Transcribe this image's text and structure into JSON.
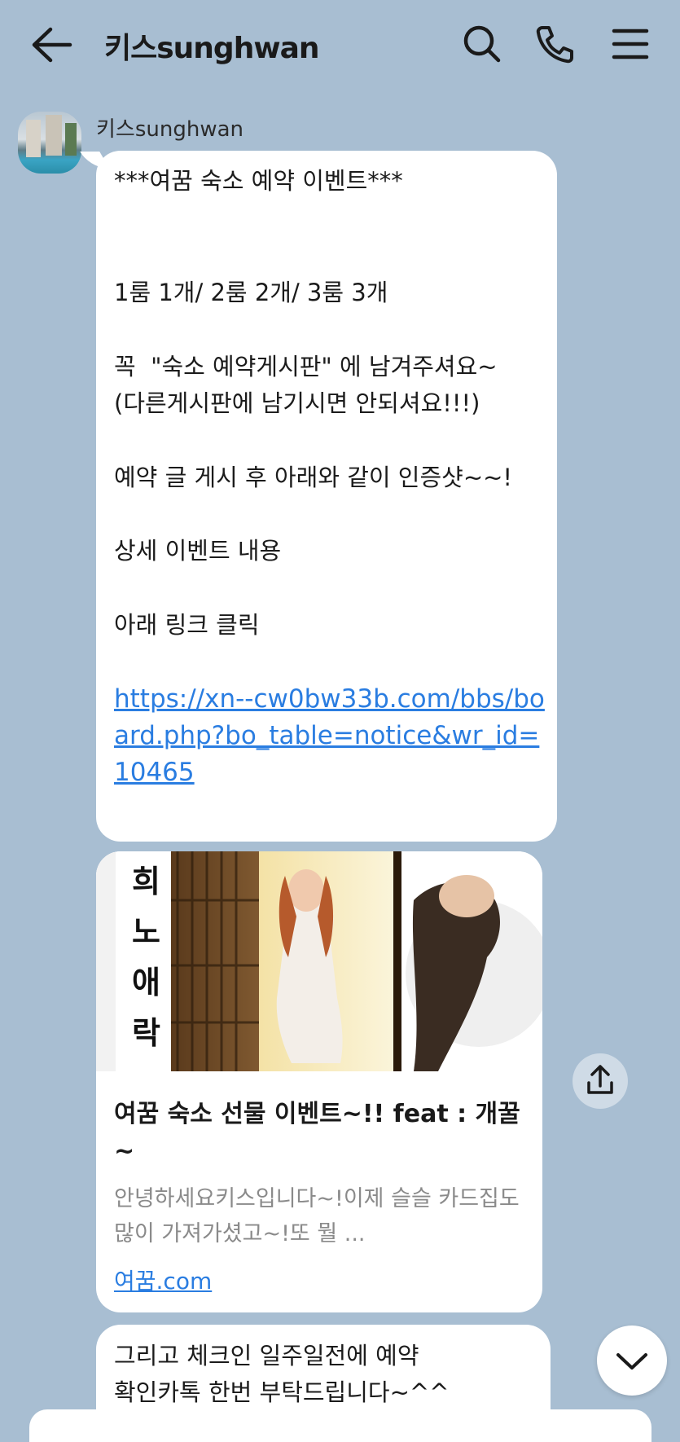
{
  "header": {
    "title": "키스sunghwan",
    "back_icon": "arrow-left-icon",
    "search_icon": "search-icon",
    "call_icon": "phone-icon",
    "menu_icon": "hamburger-menu-icon"
  },
  "sender": {
    "name": "키스sunghwan"
  },
  "messages": {
    "first": {
      "line1": "***여꿈 숙소 예약 이벤트***",
      "line2": "1룸 1개/ 2룸 2개/ 3룸 3개",
      "line3": "꼭  \"숙소 예약게시판\" 에 남겨주셔요~",
      "line4": "(다른게시판에 남기시면 안되셔요!!!)",
      "line5": "예약 글 게시 후 아래와 같이 인증샷~~!",
      "line6": "상세 이벤트 내용",
      "line7": "아래 링크 클릭",
      "link": "https://xn--cw0bw33b.com/bbs/board.php?bo_table=notice&wr_id=10465"
    },
    "link_card": {
      "title": "여꿈 숙소 선물 이벤트~!! feat : 개꿀~",
      "description": "안녕하세요키스입니다~!이제 슬슬 카드집도 많이 가져가셨고~!또 뭘 ...",
      "domain": "여꿈.com",
      "image_calligraphy": "희노애락"
    },
    "third": {
      "line1": "그리고 체크인 일주일전에 예약",
      "line2": "확인카톡 한번 부탁드립니다~^^"
    }
  },
  "controls": {
    "share_icon": "share-icon",
    "scroll_down_icon": "chevron-down-icon"
  },
  "colors": {
    "background": "#a8bed2",
    "bubble": "#ffffff",
    "link": "#2a7de1"
  }
}
